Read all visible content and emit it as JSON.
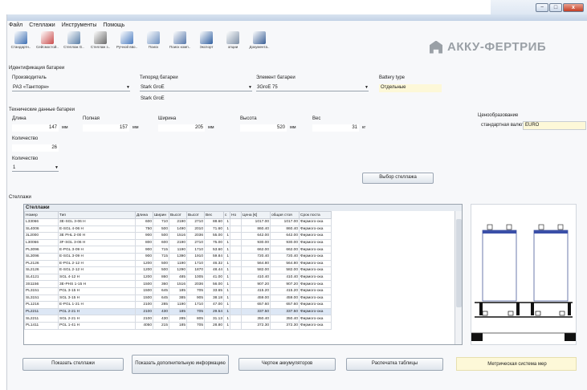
{
  "window": {
    "controls": {
      "min": "−",
      "max": "□",
      "close": "x"
    }
  },
  "menu": [
    "Файл",
    "Стеллажи",
    "Инструменты",
    "Помощь"
  ],
  "toolbar": [
    {
      "label": "Стандартн..",
      "color": "#3d6fb3"
    },
    {
      "label": "Сейсмостой..",
      "color": "#c94b4b"
    },
    {
      "label": "Стеллаж G..",
      "color": "#5a7fa8"
    },
    {
      "label": "Стеллаж з..",
      "color": "#6b6b6b"
    },
    {
      "label": "Ручной вво..",
      "color": "#4a7cc0"
    },
    {
      "label": "Поиск",
      "color": "#6c8fbf"
    },
    {
      "label": "Поиск комп..",
      "color": "#5577aa"
    },
    {
      "label": "Экспорт",
      "color": "#2f5fa0"
    },
    {
      "label": "опции",
      "color": "#7d8fa6"
    },
    {
      "label": "Документа..",
      "color": "#3a5f95"
    }
  ],
  "logo": "АККУ-ФЕРТРИБ",
  "battery_id": {
    "title": "Идентификация батареи",
    "manufacturer_label": "Производитель",
    "manufacturer": "РАЗ «Тангпорн»",
    "type_label": "Типоряд батареи",
    "type": "Stark GroE",
    "type_sub": "Stark GroE",
    "element_label": "Элемент батареи",
    "element": "3GroE 75",
    "bt_label": "Battery type",
    "bt_value": "Отдельные"
  },
  "tech": {
    "title": "Технические данные батареи",
    "len_label": "Длина",
    "len": "147",
    "full_label": "Полная",
    "full": "157",
    "width_label": "Ширина",
    "width": "205",
    "height_label": "Высота",
    "height": "520",
    "weight_label": "Вес",
    "weight": "31",
    "unit_mm": "мм",
    "unit_kg": "кг",
    "qty_label": "Количество",
    "qty": "26",
    "qty2_label": "Количество",
    "qty2": "1"
  },
  "pricing": {
    "title": "Ценообразование",
    "cur_label": "стандартная валюта",
    "cur": "EURO"
  },
  "select_button": "Выбор стеллажа",
  "racks": {
    "title": "Стеллажи",
    "caption": "Стеллажи",
    "columns": [
      "Номер",
      "Тип",
      "Длина",
      "Ширин",
      "Высот",
      "Высот",
      "Вес",
      "с",
      "Но",
      "Цена [€]",
      "общая стоя",
      "Срок поста"
    ],
    "rows": [
      [
        "L33066",
        "3E-SGL 3-06 H",
        "600",
        "710",
        "2190",
        "2710",
        "88.60",
        "1",
        "",
        "1017.00",
        "1017.00",
        "Фирмого-ока"
      ],
      [
        "SL4006",
        "E-SGL 4-06 H",
        "750",
        "500",
        "1490",
        "2010",
        "71.60",
        "1",
        "",
        "860.40",
        "860.40",
        "Фирмого-ока"
      ],
      [
        "3L2000",
        "3E PHL 2-00 H",
        "900",
        "500",
        "1516",
        "2036",
        "55.00",
        "1",
        "",
        "642.00",
        "642.00",
        "Фирмого-ока"
      ],
      [
        "L30066",
        "3F-SGL 3-06 H",
        "800",
        "600",
        "2190",
        "2710",
        "75.00",
        "1",
        "",
        "930.00",
        "930.00",
        "Фирмого-ока"
      ],
      [
        "PL3096",
        "E-PGL 3-09 H",
        "900",
        "715",
        "1190",
        "1710",
        "53.60",
        "1",
        "",
        "662.00",
        "662.00",
        "Фирмого-ока"
      ],
      [
        "SL3096",
        "E-SGL 3-09 H",
        "900",
        "715",
        "1390",
        "1910",
        "59.84",
        "1",
        "",
        "720.40",
        "720.40",
        "Фирмого-ока"
      ],
      [
        "PL2126",
        "E-PGL 2-12 H",
        "1200",
        "500",
        "1190",
        "1710",
        "46.32",
        "1",
        "",
        "564.80",
        "564.80",
        "Фирмого-ока"
      ],
      [
        "SL2126",
        "E-SGL 2-12 H",
        "1200",
        "500",
        "1290",
        "1870",
        "48.44",
        "1",
        "",
        "582.00",
        "582.00",
        "Фирмого-ока"
      ],
      [
        "SL4121",
        "SGL 4-12 H",
        "1200",
        "860",
        "485",
        "1005",
        "41.00",
        "1",
        "",
        "410.40",
        "410.40",
        "Фирмого-ока"
      ],
      [
        "3S1156",
        "3E-PHS 1-15 H",
        "1500",
        "360",
        "1516",
        "2036",
        "56.00",
        "1",
        "",
        "907.20",
        "907.20",
        "Фирмого-ока"
      ],
      [
        "PL3151",
        "PGL 3-15 H",
        "1500",
        "645",
        "185",
        "705",
        "33.65",
        "1",
        "",
        "415.20",
        "415.20",
        "Фирмого-ока"
      ],
      [
        "SL3151",
        "SGL 3-15 H",
        "1500",
        "645",
        "385",
        "905",
        "38.18",
        "1",
        "",
        "459.00",
        "459.00",
        "Фирмого-ока"
      ],
      [
        "PL1216",
        "E-PGL 1-21 H",
        "2100",
        "285",
        "1190",
        "1710",
        "47.00",
        "1",
        "",
        "657.60",
        "657.60",
        "Фирмого-ока"
      ],
      [
        "PL2211",
        "PGL 2-21 H",
        "2100",
        "430",
        "185",
        "705",
        "29.54",
        "1",
        "",
        "337.50",
        "337.50",
        "Фирмого-ока"
      ],
      [
        "SL2211",
        "SGL 2-21 H",
        "2100",
        "430",
        "285",
        "805",
        "31.13",
        "1",
        "",
        "350.40",
        "350.40",
        "Фирмого-ока"
      ],
      [
        "PL1411",
        "PGL 1-41 H",
        "4050",
        "215",
        "185",
        "705",
        "28.80",
        "1",
        "",
        "372.30",
        "372.30",
        "Фирмого-ока"
      ]
    ]
  },
  "bottom": {
    "show": "Показать стеллажи",
    "more": "Показать дополнительную информацию",
    "drawing": "Чертеж аккумуляторов",
    "print": "Распечатка таблицы",
    "metric": "Метрическая система мер"
  }
}
